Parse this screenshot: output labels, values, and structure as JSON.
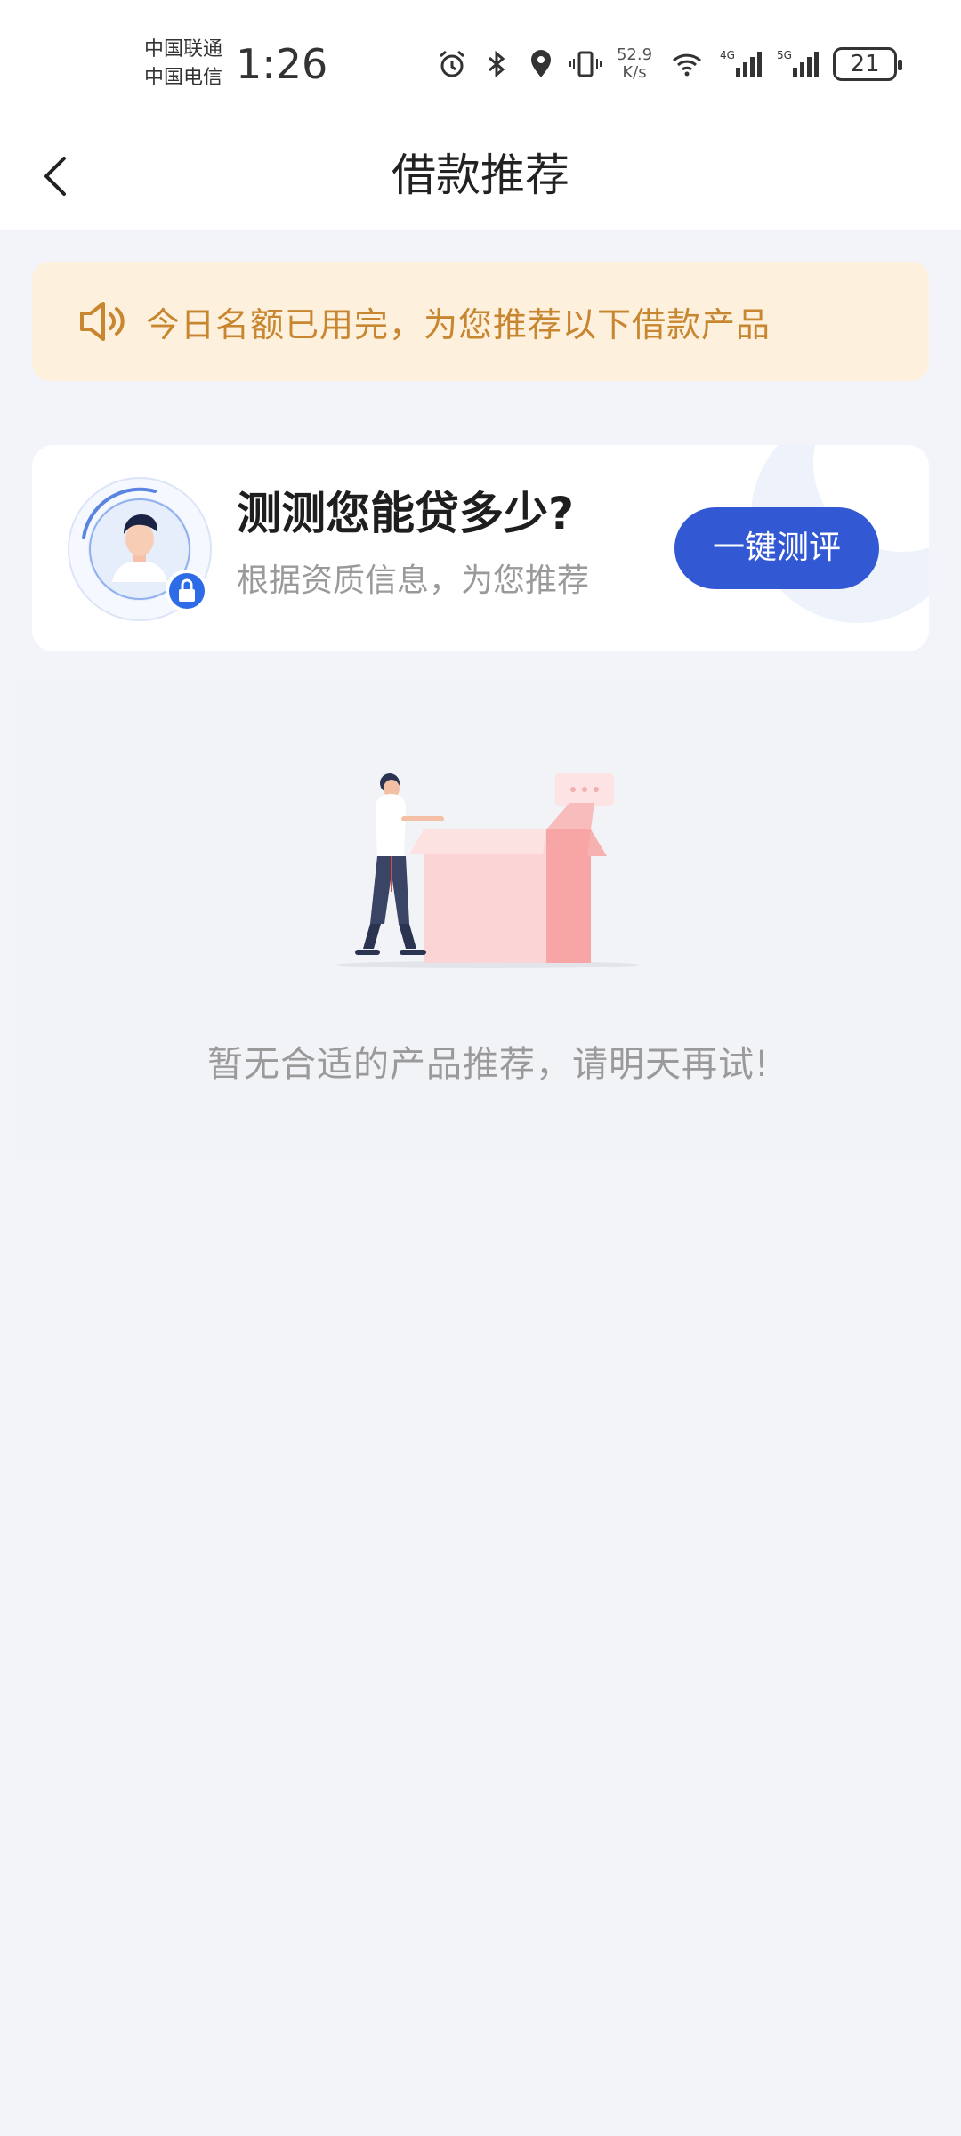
{
  "status_bar": {
    "carrier_1": "中国联通",
    "carrier_2": "中国电信",
    "time": "1:26",
    "net_speed_value": "52.9",
    "net_speed_unit": "K/s",
    "battery": "21",
    "icons": [
      "alarm-icon",
      "bluetooth-icon",
      "location-icon",
      "vibrate-icon",
      "wifi-icon",
      "signal-4g-icon",
      "signal-5g-icon",
      "battery-icon"
    ]
  },
  "nav": {
    "title": "借款推荐",
    "back_icon": "chevron-left-icon"
  },
  "notice": {
    "icon": "speaker-icon",
    "text": "今日名额已用完，为您推荐以下借款产品",
    "text_color": "#c7862f",
    "background": "#fdf0dc"
  },
  "loan_card": {
    "title": "测测您能贷多少?",
    "subtitle": "根据资质信息，为您推荐",
    "button_label": "一键测评",
    "button_color": "#3358d4"
  },
  "empty_state": {
    "message": "暂无合适的产品推荐，请明天再试!"
  }
}
